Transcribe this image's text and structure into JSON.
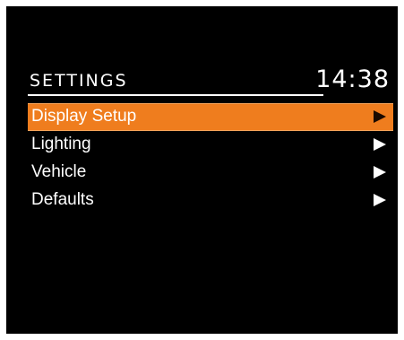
{
  "header": {
    "title": "SETTINGS",
    "time": "14:38"
  },
  "menu": {
    "items": [
      {
        "label": "Display Setup",
        "selected": true,
        "icon": "chevron-right-icon"
      },
      {
        "label": "Lighting",
        "selected": false,
        "icon": "chevron-right-icon"
      },
      {
        "label": "Vehicle",
        "selected": false,
        "icon": "chevron-right-icon"
      },
      {
        "label": "Defaults",
        "selected": false,
        "icon": "chevron-right-icon"
      }
    ]
  },
  "colors": {
    "background": "#000000",
    "highlight": "#ef7d1e",
    "text": "#ffffff"
  }
}
